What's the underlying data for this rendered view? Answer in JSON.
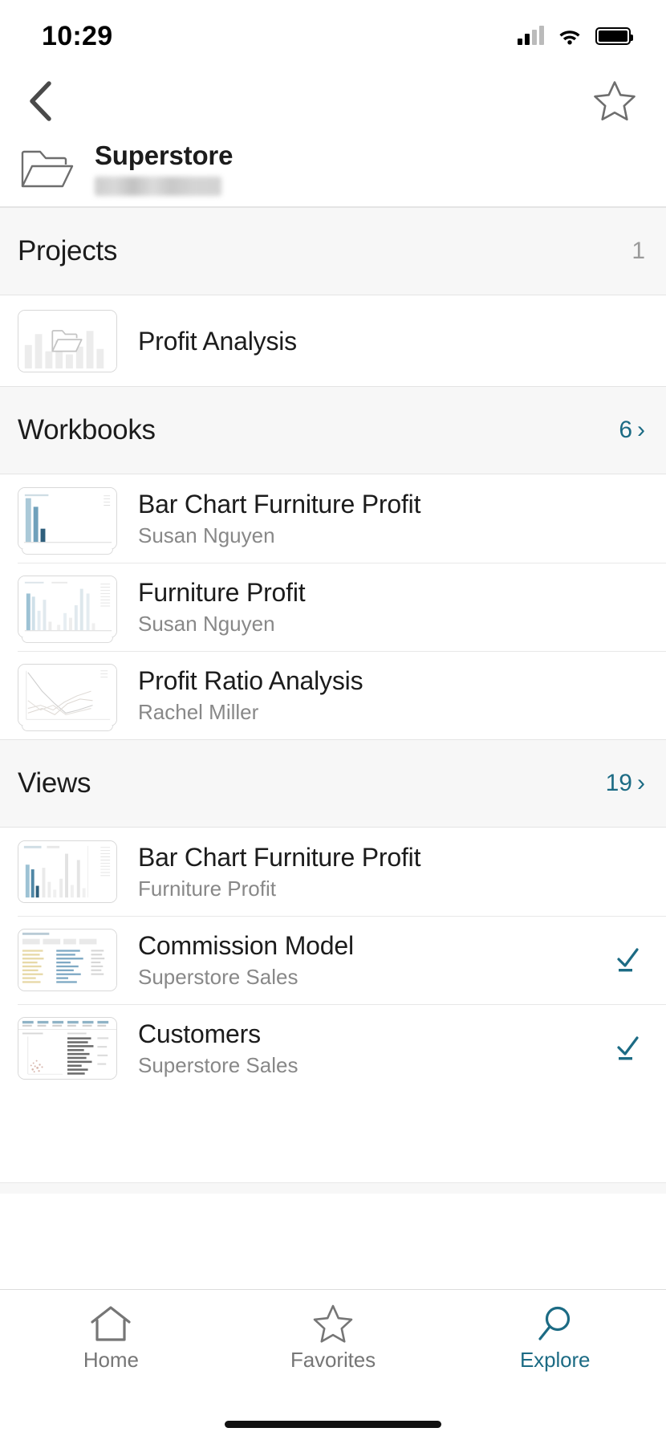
{
  "status_bar": {
    "time": "10:29",
    "signal_icon": "cellular-signal-icon",
    "wifi_icon": "wifi-icon",
    "battery_icon": "battery-full-icon"
  },
  "nav": {
    "back_icon": "chevron-left-icon",
    "favorite_icon": "star-outline-icon"
  },
  "project_header": {
    "folder_icon": "folder-open-icon",
    "title": "Superstore",
    "subtitle": "",
    "subtitle_redacted": true
  },
  "sections": [
    {
      "id": "projects",
      "title": "Projects",
      "count": "1",
      "count_is_link": false,
      "chevron": "",
      "items": [
        {
          "title": "Profit Analysis",
          "subtitle": "",
          "thumb": "project-folder-thumbnail",
          "badge": ""
        }
      ]
    },
    {
      "id": "workbooks",
      "title": "Workbooks",
      "count": "6",
      "count_is_link": true,
      "chevron": "›",
      "items": [
        {
          "title": "Bar Chart Furniture Profit",
          "subtitle": "Susan Nguyen",
          "thumb": "bar-chart-thumbnail",
          "badge": ""
        },
        {
          "title": "Furniture Profit",
          "subtitle": "Susan Nguyen",
          "thumb": "bar-chart-dense-thumbnail",
          "badge": ""
        },
        {
          "title": "Profit Ratio Analysis",
          "subtitle": "Rachel Miller",
          "thumb": "line-chart-thumbnail",
          "badge": ""
        }
      ]
    },
    {
      "id": "views",
      "title": "Views",
      "count": "19",
      "count_is_link": true,
      "chevron": "›",
      "items": [
        {
          "title": "Bar Chart Furniture Profit",
          "subtitle": "Furniture Profit",
          "thumb": "bar-chart-view-thumbnail",
          "badge": ""
        },
        {
          "title": "Commission Model",
          "subtitle": "Superstore Sales",
          "thumb": "dashboard-table-thumbnail",
          "badge": "certified-check-icon"
        },
        {
          "title": "Customers",
          "subtitle": "Superstore Sales",
          "thumb": "customers-dashboard-thumbnail",
          "badge": "certified-check-icon"
        }
      ]
    }
  ],
  "tabbar": {
    "items": [
      {
        "label": "Home",
        "icon": "home-icon",
        "active": false
      },
      {
        "label": "Favorites",
        "icon": "star-outline-icon",
        "active": false
      },
      {
        "label": "Explore",
        "icon": "search-icon",
        "active": true
      }
    ]
  },
  "colors": {
    "accent": "#1c6b84",
    "text_primary": "#1c1c1c",
    "text_secondary": "#888888",
    "section_bg": "#f7f7f7",
    "divider": "#e4e4e4"
  }
}
